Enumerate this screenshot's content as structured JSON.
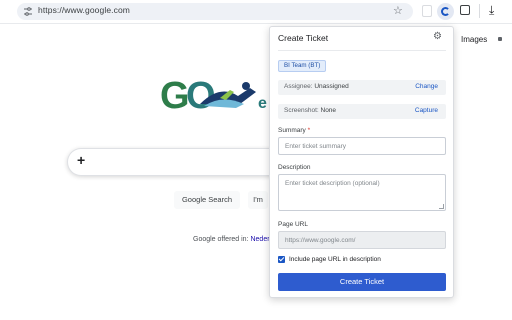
{
  "browser": {
    "url": "https://www.google.com",
    "icons": [
      "tune-icon",
      "star-icon",
      "extension-icon",
      "puzzle-icon",
      "download-icon"
    ]
  },
  "google": {
    "images_link": "Images",
    "search_button": "Google Search",
    "lucky_button": "I'm",
    "offered_in": "Google offered in:",
    "offered_lang": "Neder",
    "plus_glyph": "+"
  },
  "popup": {
    "title": "Create Ticket",
    "team_badge": "BI Team (BT)",
    "assignee": {
      "label": "Assignee:",
      "value": "Unassigned",
      "action": "Change"
    },
    "screenshot": {
      "label": "Screenshot:",
      "value": "None",
      "action": "Capture"
    },
    "summary": {
      "label": "Summary",
      "required_mark": "*",
      "placeholder": "Enter ticket summary"
    },
    "description": {
      "label": "Description",
      "placeholder": "Enter ticket description (optional)"
    },
    "page_url": {
      "label": "Page URL",
      "value": "https://www.google.com/"
    },
    "include_url": {
      "label": "Include page URL in description",
      "checked": true
    },
    "submit_label": "Create Ticket",
    "accent_color": "#2e5ccf"
  }
}
